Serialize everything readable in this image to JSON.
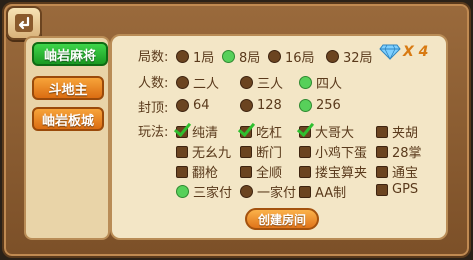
{
  "sidebar": {
    "tabs": [
      {
        "label": "岫岩麻将"
      },
      {
        "label": "斗地主"
      },
      {
        "label": "岫岩板城"
      }
    ]
  },
  "rounds": {
    "label": "局数:",
    "options": [
      {
        "label": "1局",
        "selected": false
      },
      {
        "label": "8局",
        "selected": true
      },
      {
        "label": "16局",
        "selected": false
      },
      {
        "label": "32局",
        "selected": false
      }
    ],
    "cost": "X 4"
  },
  "players": {
    "label": "人数:",
    "options": [
      {
        "label": "二人",
        "selected": false
      },
      {
        "label": "三人",
        "selected": false
      },
      {
        "label": "四人",
        "selected": true
      }
    ]
  },
  "cap": {
    "label": "封顶:",
    "options": [
      {
        "label": "64",
        "selected": false
      },
      {
        "label": "128",
        "selected": false
      },
      {
        "label": "256",
        "selected": true
      }
    ]
  },
  "rules": {
    "label": "玩法:",
    "options": [
      {
        "label": "纯清",
        "checked": true
      },
      {
        "label": "吃杠",
        "checked": true
      },
      {
        "label": "大哥大",
        "checked": true
      },
      {
        "label": "夹胡",
        "checked": false
      },
      {
        "label": "无幺九",
        "checked": false
      },
      {
        "label": "断门",
        "checked": false
      },
      {
        "label": "小鸡下蛋",
        "checked": false
      },
      {
        "label": "28掌",
        "checked": false
      },
      {
        "label": "翻枪",
        "checked": false
      },
      {
        "label": "全顺",
        "checked": false
      },
      {
        "label": "搂宝算夹",
        "checked": false
      },
      {
        "label": "通宝",
        "checked": false
      },
      {
        "label": "三家付",
        "checked": true,
        "radio": true
      },
      {
        "label": "一家付",
        "checked": false,
        "radio": true
      },
      {
        "label": "AA制",
        "checked": false
      },
      {
        "label": "GPS",
        "checked": false
      }
    ]
  },
  "create_button": "创建房间"
}
